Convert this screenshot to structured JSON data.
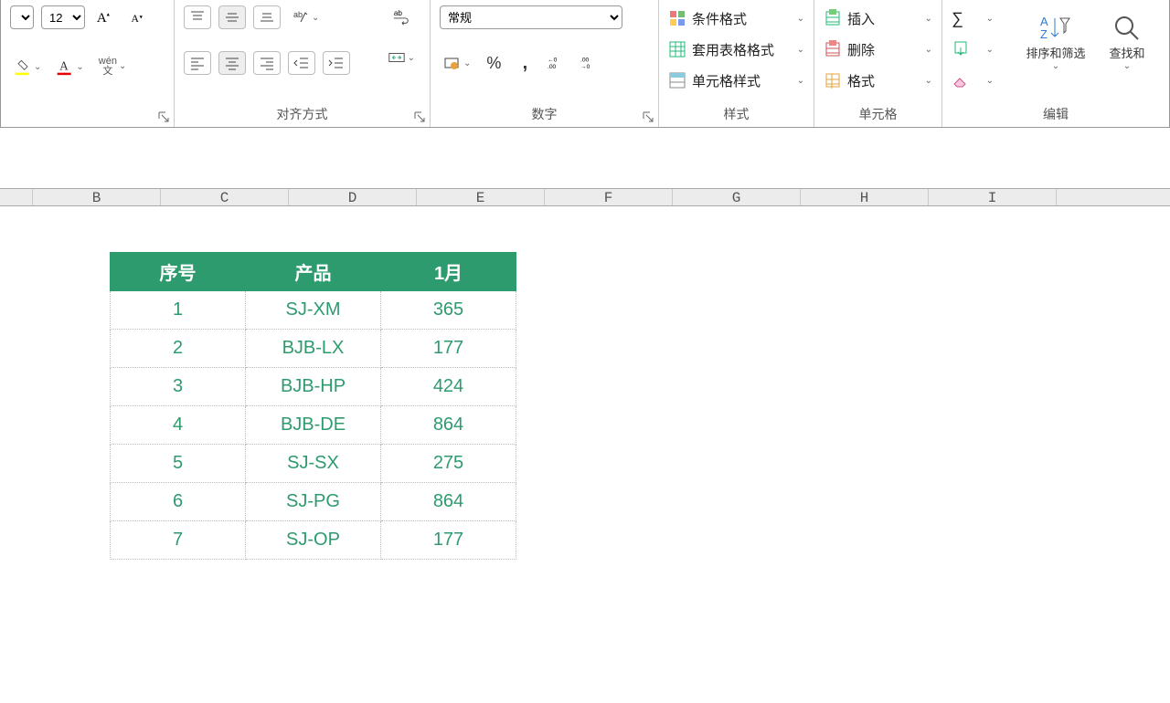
{
  "font": {
    "size": "12"
  },
  "ribbon": {
    "align_label": "对齐方式",
    "number_label": "数字",
    "number_format": "常规",
    "styles_label": "样式",
    "styles": {
      "cond": "条件格式",
      "table": "套用表格格式",
      "cell": "单元格样式"
    },
    "cells_label": "单元格",
    "cells": {
      "insert": "插入",
      "delete": "删除",
      "format": "格式"
    },
    "edit_label": "编辑",
    "edit": {
      "sort": "排序和筛选",
      "find": "查找和"
    },
    "phonetic": "wén\n文"
  },
  "columns": [
    "",
    "B",
    "C",
    "D",
    "E",
    "F",
    "G",
    "H",
    "I"
  ],
  "table": {
    "headers": [
      "序号",
      "产品",
      "1月"
    ],
    "rows": [
      {
        "n": "1",
        "p": "SJ-XM",
        "v": "365"
      },
      {
        "n": "2",
        "p": "BJB-LX",
        "v": "177"
      },
      {
        "n": "3",
        "p": "BJB-HP",
        "v": "424"
      },
      {
        "n": "4",
        "p": "BJB-DE",
        "v": "864"
      },
      {
        "n": "5",
        "p": "SJ-SX",
        "v": "275"
      },
      {
        "n": "6",
        "p": "SJ-PG",
        "v": "864"
      },
      {
        "n": "7",
        "p": "SJ-OP",
        "v": "177"
      }
    ]
  }
}
